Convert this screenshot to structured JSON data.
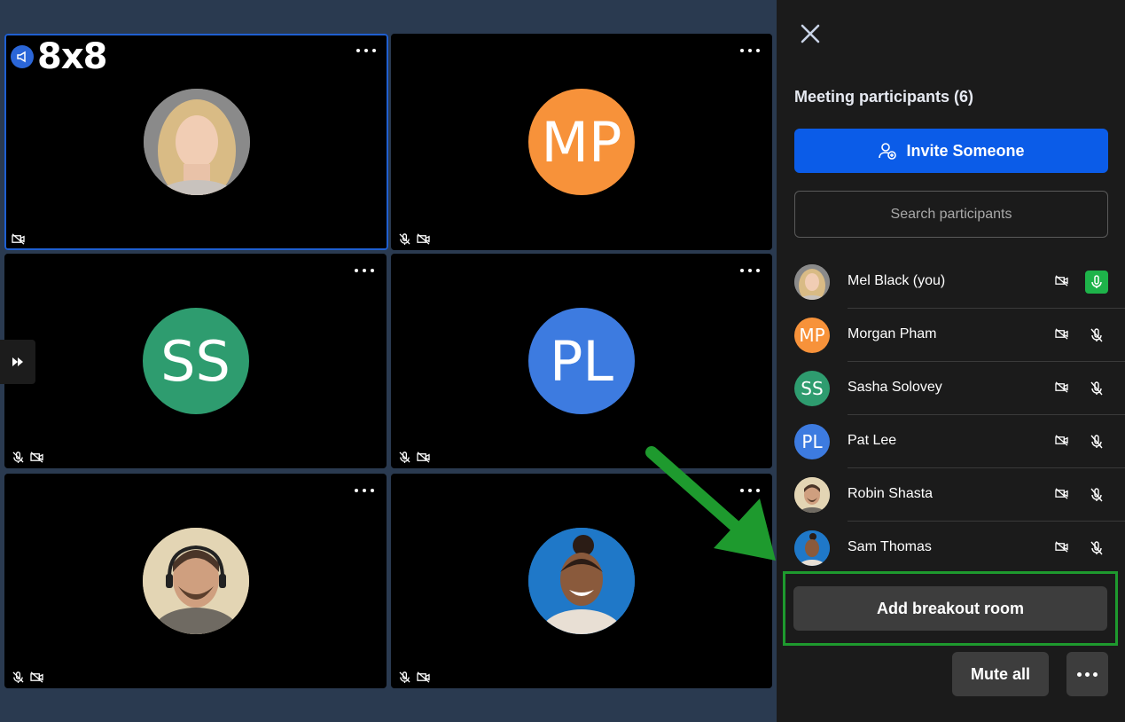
{
  "brand": {
    "logo_text": "8x8"
  },
  "tiles": [
    {
      "initials": "",
      "color": "#ffffff",
      "photo": "woman-blonde"
    },
    {
      "initials": "MP",
      "color": "#f7923a"
    },
    {
      "initials": "SS",
      "color": "#2e9c6f"
    },
    {
      "initials": "PL",
      "color": "#3d7be0"
    },
    {
      "initials": "",
      "color": "#ffffff",
      "photo": "man-headset"
    },
    {
      "initials": "",
      "color": "#ffffff",
      "photo": "woman-blue-bg"
    }
  ],
  "panel": {
    "title": "Meeting participants (6)",
    "invite_label": "Invite Someone",
    "search_placeholder": "Search participants",
    "participants": [
      {
        "name": "Mel Black (you)",
        "initials": "",
        "color": "#ffffff"
      },
      {
        "name": "Morgan Pham",
        "initials": "MP",
        "color": "#f7923a"
      },
      {
        "name": "Sasha Solovey",
        "initials": "SS",
        "color": "#2e9c6f"
      },
      {
        "name": "Pat Lee",
        "initials": "PL",
        "color": "#3d7be0"
      },
      {
        "name": "Robin Shasta",
        "initials": "",
        "color": "#ffffff"
      },
      {
        "name": "Sam Thomas",
        "initials": "",
        "color": "#ffffff"
      }
    ],
    "add_breakout_label": "Add breakout room",
    "mute_all_label": "Mute all"
  },
  "colors": {
    "accent_blue": "#0b5ce8",
    "highlight_green": "#1e9a2e",
    "mic_on_green": "#1eb34a"
  }
}
